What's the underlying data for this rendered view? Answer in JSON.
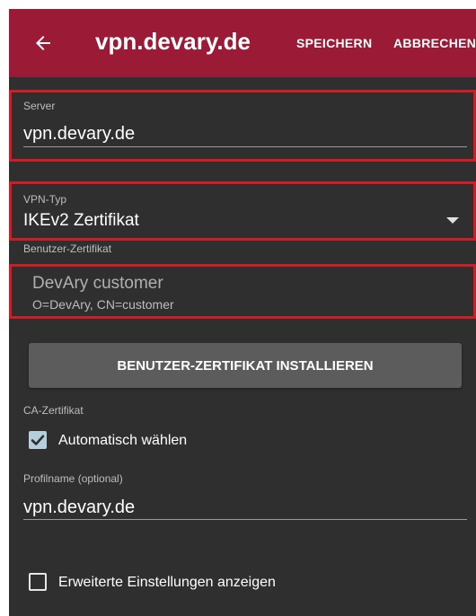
{
  "appbar": {
    "title": "vpn.devary.de",
    "save_label": "SPEICHERN",
    "cancel_label": "ABBRECHEN",
    "back_icon": "arrow-left-icon",
    "background_color": "#9b1b36"
  },
  "server": {
    "label": "Server",
    "value": "vpn.devary.de"
  },
  "vpn_type": {
    "label": "VPN-Typ",
    "selected": "IKEv2 Zertifikat"
  },
  "user_certificate": {
    "label": "Benutzer-Zertifikat",
    "name": "DevAry customer",
    "subject": "O=DevAry, CN=customer",
    "install_button": "BENUTZER-ZERTIFIKAT INSTALLIEREN"
  },
  "ca_certificate": {
    "label": "CA-Zertifikat",
    "auto_select_label": "Automatisch wählen",
    "auto_select_checked": true
  },
  "profile_name": {
    "label": "Profilname (optional)",
    "value": "vpn.devary.de"
  },
  "advanced": {
    "label": "Erweiterte Einstellungen anzeigen",
    "checked": false
  },
  "colors": {
    "highlight": "#d01c24",
    "background": "#2f2f2f"
  }
}
